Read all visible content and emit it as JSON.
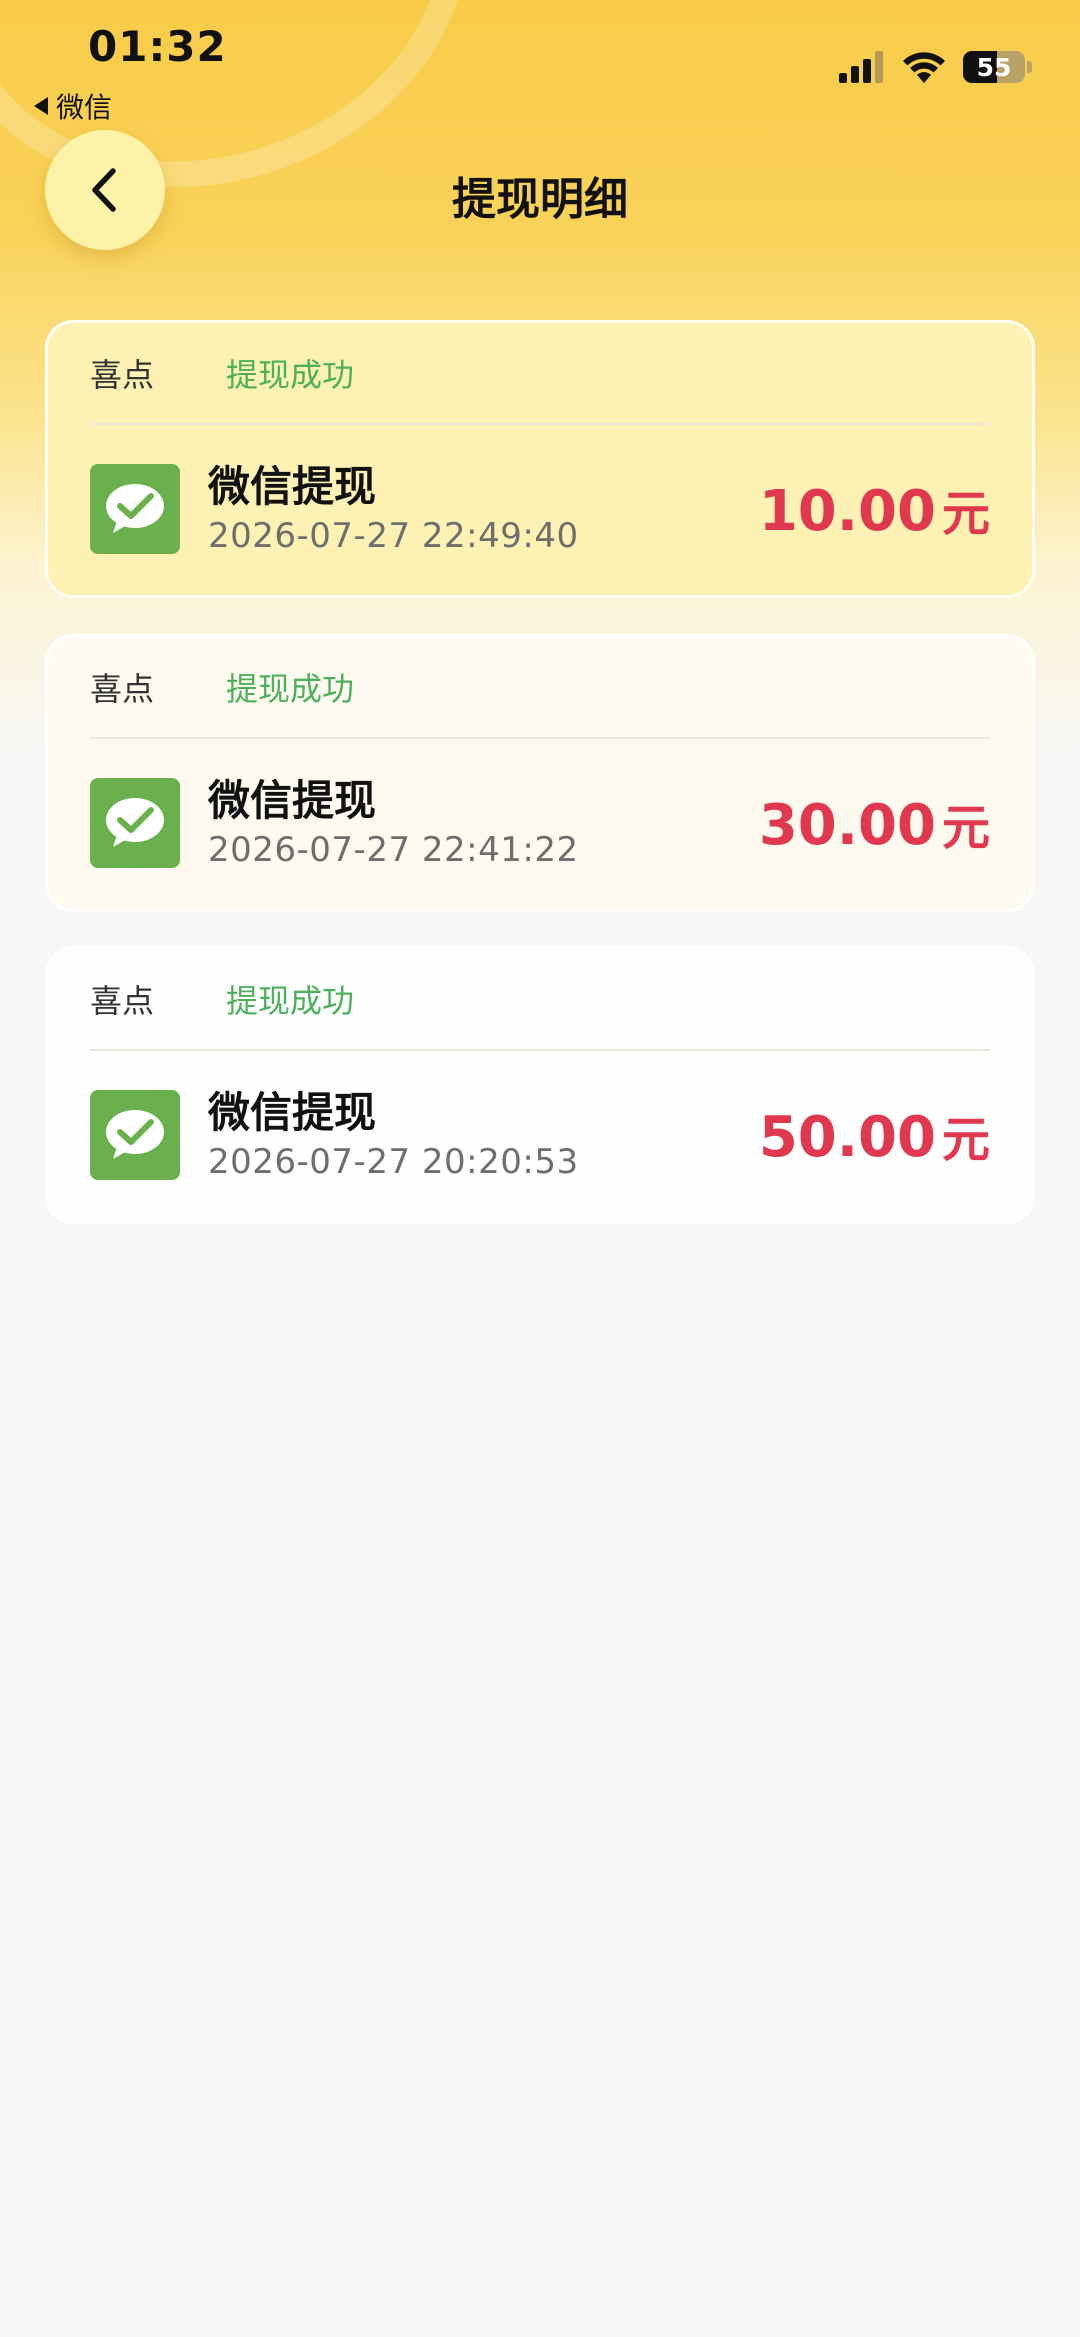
{
  "status_bar": {
    "time": "01:32",
    "back_app": "微信",
    "battery": "55",
    "battery_level": 0.55
  },
  "header": {
    "title": "提现明细"
  },
  "records": [
    {
      "source": "喜点",
      "status": "提现成功",
      "name": "微信提现",
      "time": "2026-07-27 22:49:40",
      "amount": "10.00",
      "unit": "元"
    },
    {
      "source": "喜点",
      "status": "提现成功",
      "name": "微信提现",
      "time": "2026-07-27 22:41:22",
      "amount": "30.00",
      "unit": "元"
    },
    {
      "source": "喜点",
      "status": "提现成功",
      "name": "微信提现",
      "time": "2026-07-27 20:20:53",
      "amount": "50.00",
      "unit": "元"
    }
  ],
  "colors": {
    "header_yellow": "#f8cc48",
    "success_green": "#4cb05c",
    "amount_red": "#e0394f",
    "wechat_green": "#6ab04c"
  },
  "icons": {
    "back": "chevron-left-icon",
    "wechat": "wechat-icon",
    "signal": "signal-icon",
    "wifi": "wifi-icon",
    "battery": "battery-icon"
  }
}
